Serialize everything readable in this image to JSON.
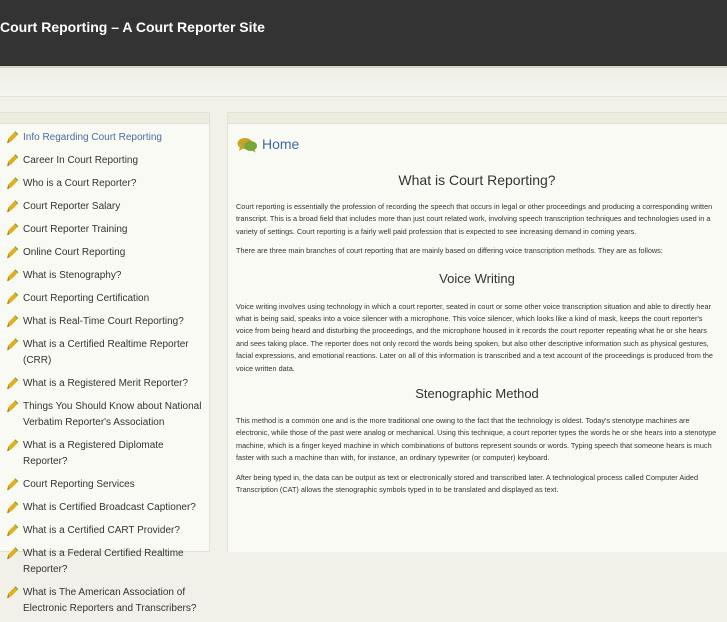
{
  "header": {
    "title": "Court Reporting – A Court Reporter Site"
  },
  "sidebar": {
    "items": [
      {
        "label": "Info Regarding Court Reporting",
        "active": true
      },
      {
        "label": "Career In Court Reporting"
      },
      {
        "label": "Who is a Court Reporter?"
      },
      {
        "label": "Court Reporter Salary"
      },
      {
        "label": "Court Reporter Training"
      },
      {
        "label": "Online Court Reporting"
      },
      {
        "label": "What is Stenography?"
      },
      {
        "label": "Court Reporting Certification"
      },
      {
        "label": "What is Real-Time Court Reporting?"
      },
      {
        "label": "What is a Certified Realtime Reporter (CRR)"
      },
      {
        "label": "What is a Registered Merit Reporter?"
      },
      {
        "label": "Things You Should Know about National Verbatim Reporter's Association"
      },
      {
        "label": "What is a Registered Diplomate Reporter?"
      },
      {
        "label": "Court Reporting Services"
      },
      {
        "label": "What is Certified Broadcast Captioner?"
      },
      {
        "label": "What is a Certified CART Provider?"
      },
      {
        "label": "What is a Federal Certified Realtime Reporter?"
      },
      {
        "label": "What is The American Association of Electronic Reporters and Transcribers?"
      }
    ]
  },
  "main": {
    "breadcrumb": "Home",
    "title": "What is Court Reporting?",
    "intro": "Court reporting is essentially the profession of recording the speech that occurs in legal or other proceedings and producing a corresponding written transcript. This is a broad field that includes more than just court related work, involving speech transcription techniques and technologies used in a variety of settings. Court reporting is a fairly well paid profession that is expected to see increasing demand in coming years.",
    "branches": "There are three main branches of court reporting that are mainly based on differing voice transcription methods. They are as follows:",
    "voice_heading": "Voice Writing",
    "voice_text": "Voice writing involves using technology in which a court reporter, seated in court or some other voice transcription situation and able to directly hear what is being said, speaks into a voice silencer with a microphone. This voice silencer, which looks like a kind of mask, keeps the court reporter's voice from being heard and disturbing the proceedings, and the microphone housed in it records the court reporter repeating what he or she hears and sees taking place. The reporter does not only record the words being spoken, but also other descriptive information such as physical gestures, facial expressions, and emotional reactions. Later on all of this information is transcribed and a text account of the proceedings is produced from the voice written data.",
    "steno_heading": "Stenographic Method",
    "steno_text": "This method is a common one and is the more traditional one owing to the fact that the technology is oldest. Today's stenotype machines are electronic, while those of the past were analog or mechanical. Using this technique, a court reporter types the words he or she hears into a stenotype machine, which is a finger keyed machine in which combinations of buttons represent sounds or words. Typing speech that someone hears is much faster with such a machine than with, for instance, an ordinary typewriter (or computer) keyboard.",
    "steno_text2": "After being typed in, the data can be output as text or electronically stored and transcribed later. A technological process called Computer Aided Transcription (CAT) allows the stenographic symbols typed in to be translated and displayed as text."
  },
  "colors": {
    "header_bg": "#333333",
    "page_bg": "#f1f1e9",
    "panel_bg": "#fafaf5",
    "link": "#3f6b9e",
    "icon_yellow": "#e0b020",
    "icon_green": "#6f9a2e"
  },
  "icons": {
    "nav": "pencil-icon",
    "breadcrumb": "chat-bubbles-icon"
  }
}
